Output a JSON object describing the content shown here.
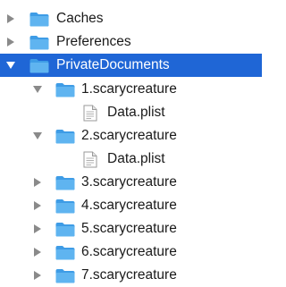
{
  "tree": {
    "caches": {
      "label": "Caches",
      "icon": "folder-icon"
    },
    "preferences": {
      "label": "Preferences",
      "icon": "folder-icon"
    },
    "private_documents": {
      "label": "PrivateDocuments",
      "icon": "folder-icon",
      "expanded": true,
      "selected": true,
      "children": [
        {
          "label": "1.scarycreature",
          "icon": "folder-icon",
          "expanded": true,
          "children": [
            {
              "label": "Data.plist",
              "icon": "plist-file-icon"
            }
          ]
        },
        {
          "label": "2.scarycreature",
          "icon": "folder-icon",
          "expanded": true,
          "children": [
            {
              "label": "Data.plist",
              "icon": "plist-file-icon"
            }
          ]
        },
        {
          "label": "3.scarycreature",
          "icon": "folder-icon",
          "expanded": false
        },
        {
          "label": "4.scarycreature",
          "icon": "folder-icon",
          "expanded": false
        },
        {
          "label": "5.scarycreature",
          "icon": "folder-icon",
          "expanded": false
        },
        {
          "label": "6.scarycreature",
          "icon": "folder-icon",
          "expanded": false
        },
        {
          "label": "7.scarycreature",
          "icon": "folder-icon",
          "expanded": false
        }
      ]
    }
  },
  "colors": {
    "selection": "#1f66d6",
    "folder": "#5fb4f0",
    "folder_tab": "#3e9ce6",
    "disclosure": "#8a8a8a"
  }
}
